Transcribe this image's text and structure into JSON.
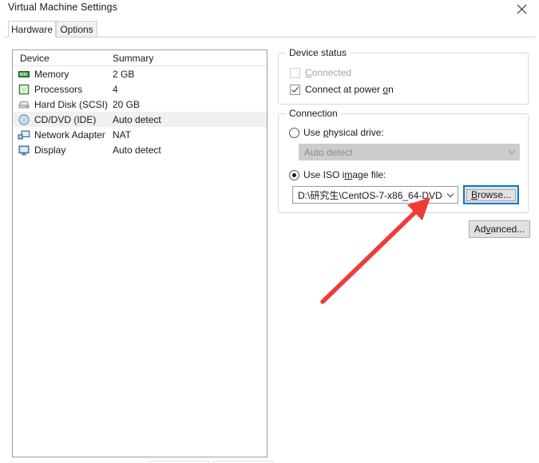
{
  "window": {
    "title": "Virtual Machine Settings",
    "close_icon": "close-x-icon"
  },
  "tabs": [
    {
      "label": "Hardware",
      "selected": true
    },
    {
      "label": "Options",
      "selected": false
    }
  ],
  "device_list": {
    "columns": [
      "Device",
      "Summary"
    ],
    "rows": [
      {
        "icon": "memory-icon",
        "device": "Memory",
        "summary": "2 GB",
        "selected": false
      },
      {
        "icon": "processor-icon",
        "device": "Processors",
        "summary": "4",
        "selected": false
      },
      {
        "icon": "hard-disk-icon",
        "device": "Hard Disk (SCSI)",
        "summary": "20 GB",
        "selected": false
      },
      {
        "icon": "cd-dvd-icon",
        "device": "CD/DVD (IDE)",
        "summary": "Auto detect",
        "selected": true
      },
      {
        "icon": "network-adapter-icon",
        "device": "Network Adapter",
        "summary": "NAT",
        "selected": false
      },
      {
        "icon": "display-icon",
        "device": "Display",
        "summary": "Auto detect",
        "selected": false
      }
    ]
  },
  "device_status": {
    "title": "Device status",
    "connected": {
      "label": "Connected",
      "mnemonic": "C",
      "checked": false,
      "enabled": false
    },
    "connect_at_power_on": {
      "label_a": "Connect at power ",
      "mnemonic": "o",
      "label_b": "n",
      "checked": true,
      "enabled": true
    }
  },
  "connection": {
    "title": "Connection",
    "use_physical_drive": {
      "label_a": "Use ",
      "mnemonic": "p",
      "label_b": "hysical drive:",
      "selected": false
    },
    "physical_drive_combo": {
      "value": "Auto detect",
      "enabled": false
    },
    "use_iso_image_file": {
      "label_a": "Use ISO i",
      "mnemonic": "m",
      "label_b": "age file:",
      "selected": true
    },
    "iso_path_combo": {
      "value": "D:\\研究生\\CentOS-7-x86_64-DVD-",
      "enabled": true
    },
    "browse_button": {
      "label_a": "B",
      "mnemonic": "B",
      "label_b": "rowse...",
      "full": "Browse...",
      "focused": true
    },
    "advanced_button": {
      "label_a": "Ad",
      "mnemonic": "v",
      "label_b": "anced...",
      "full": "Advanced...",
      "focused": false
    }
  },
  "annotation": {
    "arrow_color": "#f03b3b",
    "arrow_name": "red-arrow-pointing-to-iso-path"
  },
  "colors": {
    "focus_blue": "#0078d7",
    "selected_row": "#f0f0f0",
    "disabled_text": "#a6a6a6"
  }
}
